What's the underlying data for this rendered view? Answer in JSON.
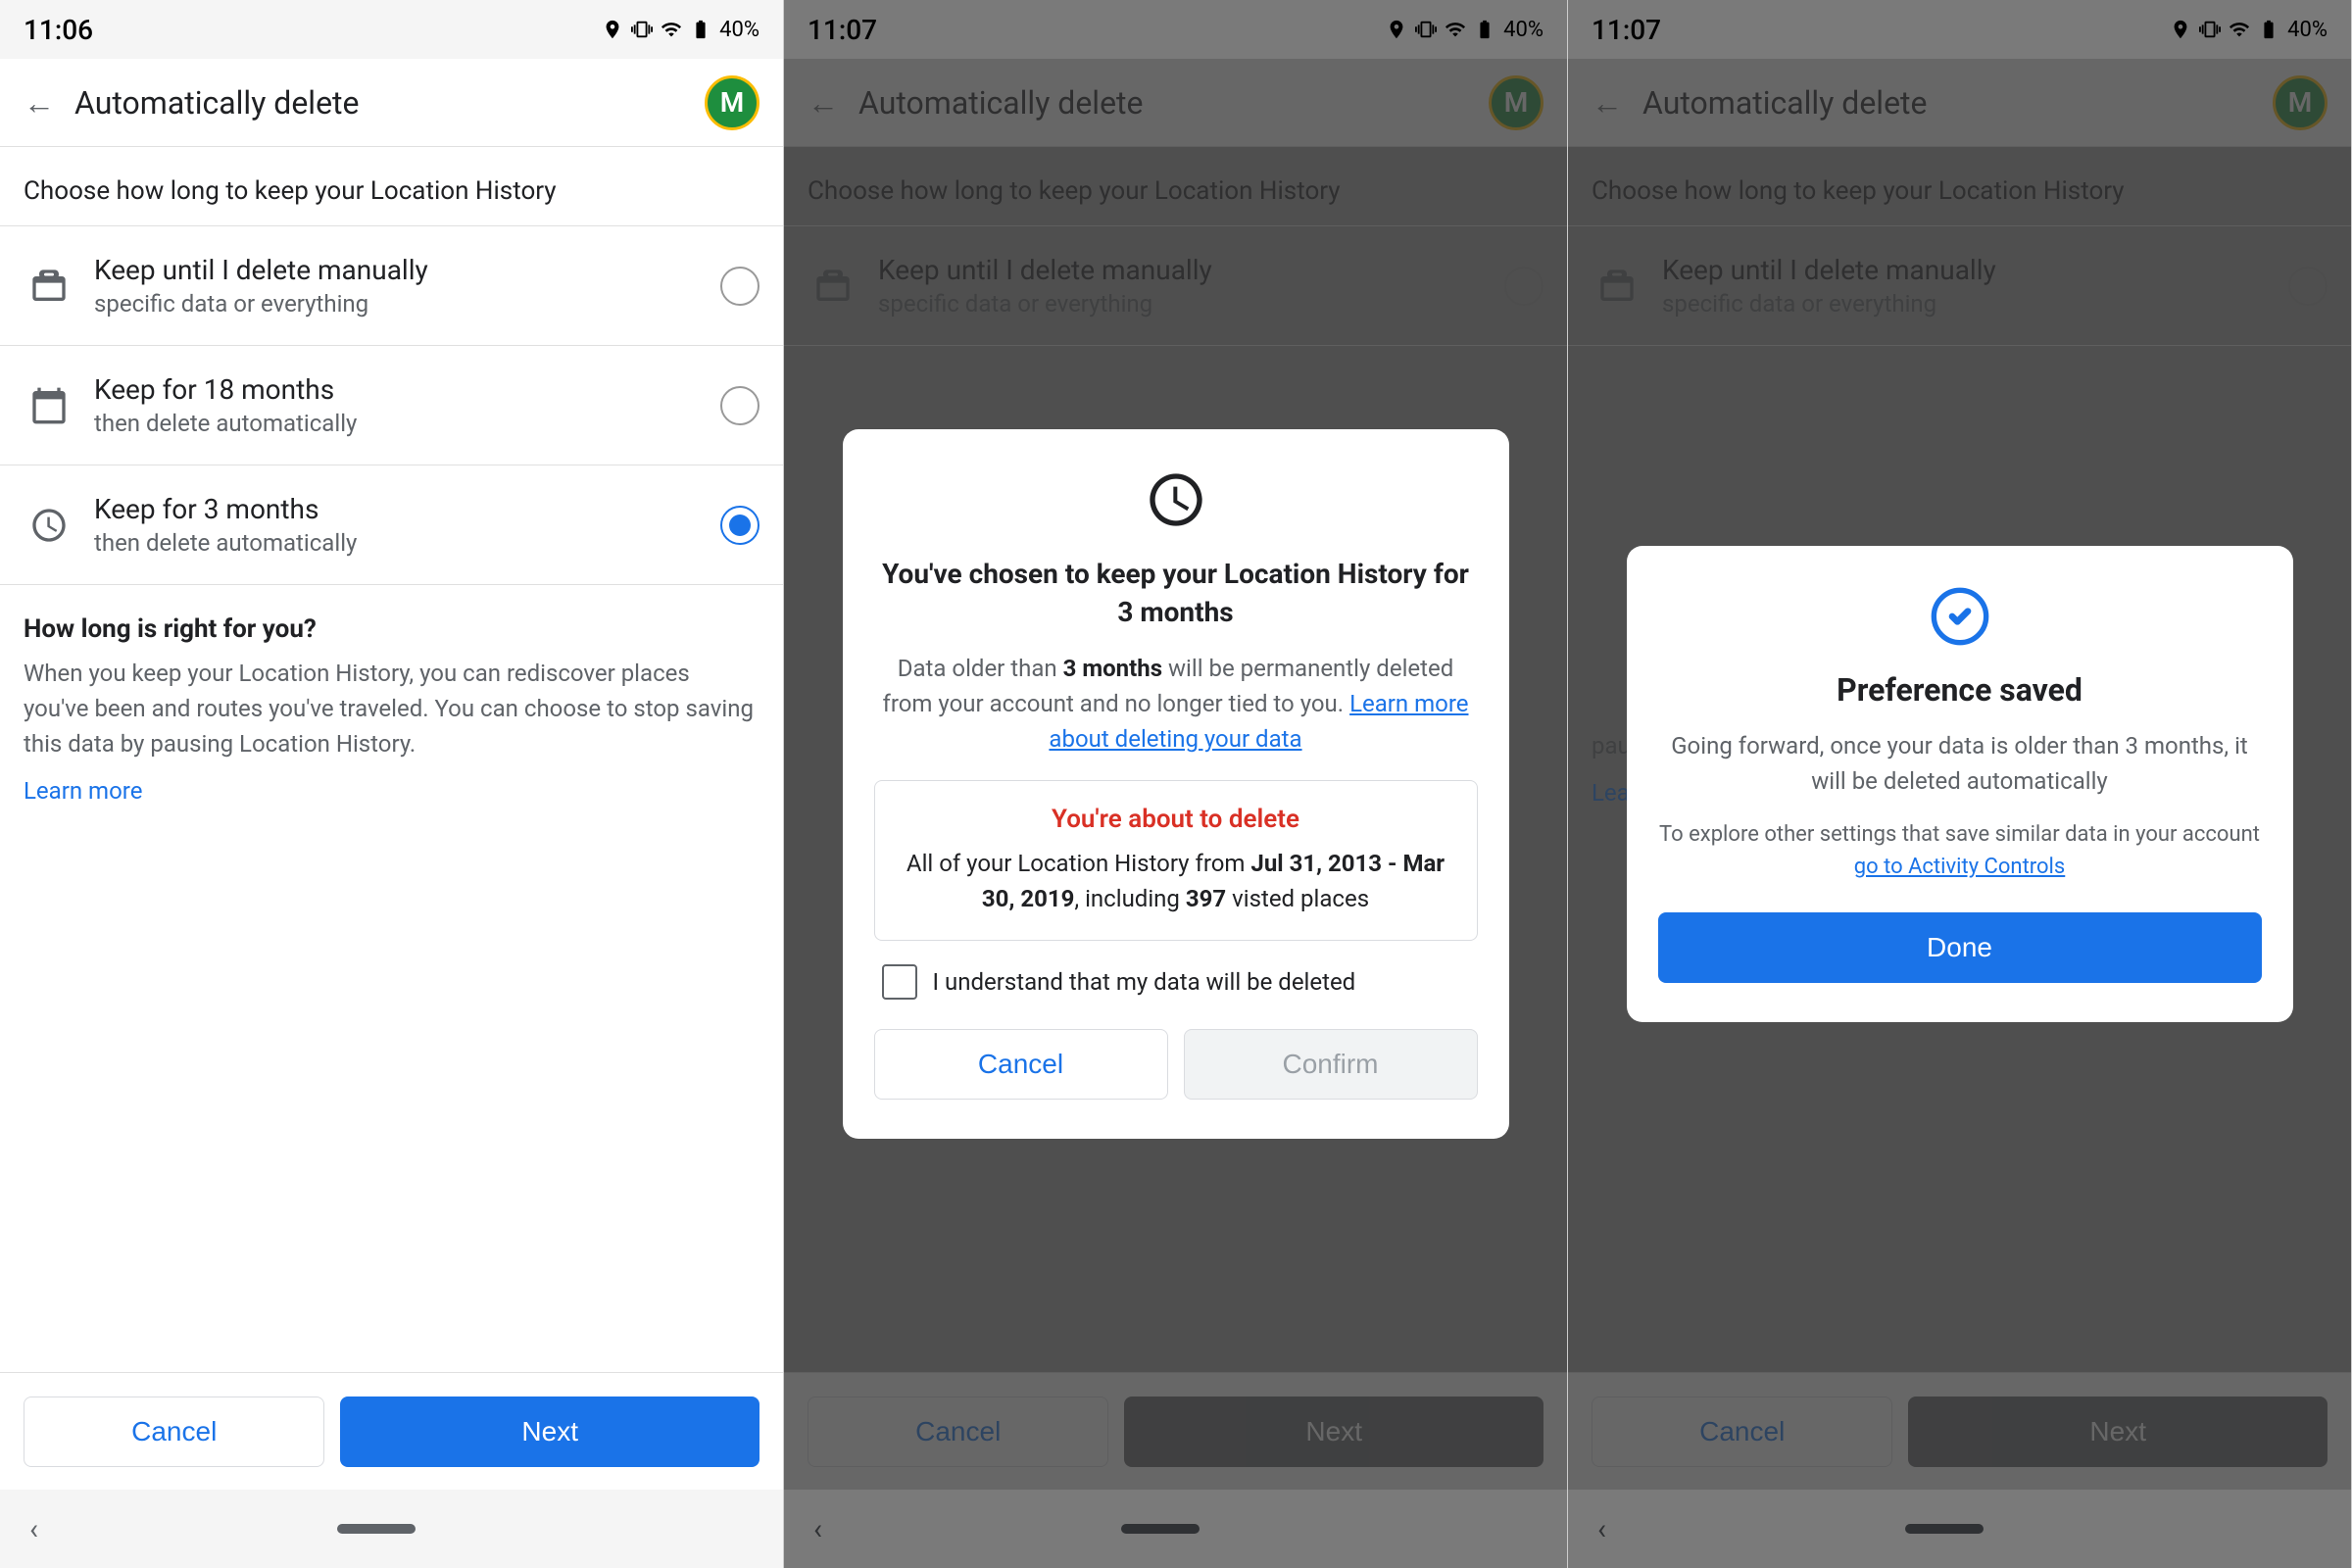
{
  "panels": [
    {
      "id": "panel1",
      "statusBar": {
        "time": "11:06",
        "battery": "40%"
      },
      "header": {
        "title": "Automatically delete",
        "avatarLetter": "M"
      },
      "subtitle": "Choose how long to keep your Location History",
      "options": [
        {
          "id": "opt-manual",
          "icon": "briefcase",
          "title": "Keep until I delete manually",
          "subtitle": "specific data or everything",
          "selected": false
        },
        {
          "id": "opt-18months",
          "icon": "calendar",
          "title": "Keep for 18 months",
          "subtitle": "then delete automatically",
          "selected": false
        },
        {
          "id": "opt-3months",
          "icon": "clock",
          "title": "Keep for 3 months",
          "subtitle": "then delete automatically",
          "selected": true
        }
      ],
      "infoTitle": "How long is right for you?",
      "infoText": "When you keep your Location History, you can rediscover places you've been and routes you've traveled. You can choose to stop saving this data by pausing Location History.",
      "infoLink": "Learn more",
      "cancelLabel": "Cancel",
      "nextLabel": "Next"
    },
    {
      "id": "panel2",
      "statusBar": {
        "time": "11:07",
        "battery": "40%"
      },
      "header": {
        "title": "Automatically delete",
        "avatarLetter": "M"
      },
      "subtitle": "Choose how long to keep your Location History",
      "options": [
        {
          "id": "opt-manual2",
          "icon": "briefcase",
          "title": "Keep until I delete manually",
          "subtitle": "specific data or everything",
          "selected": false
        }
      ],
      "cancelLabel": "Cancel",
      "nextLabel": "Next",
      "dialog": {
        "iconType": "clock",
        "title": "You've chosen to keep your Location History for 3 months",
        "body": "Data older than",
        "boldPart": "3 months",
        "bodyContinue": "will be permanently deleted from your account and no longer tied to you.",
        "link": "Learn more about deleting your data",
        "warningTitle": "You're about to delete",
        "warningText": "All of your Location History from",
        "warningBold1": "Jul 31, 2013 - Mar 30, 2019",
        "warningContinue": ", including",
        "warningBold2": "397",
        "warningEnd": "visted places",
        "checkboxLabel": "I understand that my data will be deleted",
        "cancelLabel": "Cancel",
        "confirmLabel": "Confirm"
      }
    },
    {
      "id": "panel3",
      "statusBar": {
        "time": "11:07",
        "battery": "40%"
      },
      "header": {
        "title": "Automatically delete",
        "avatarLetter": "M"
      },
      "subtitle": "Choose how long to keep your Location History",
      "options": [
        {
          "id": "opt-manual3",
          "icon": "briefcase",
          "title": "Keep until I delete manually",
          "subtitle": "specific data or everything",
          "selected": false
        }
      ],
      "cancelLabel": "Cancel",
      "nextLabel": "Next",
      "infoText": "pausing Location History.",
      "infoLink": "Learn more",
      "prefDialog": {
        "iconType": "check-circle",
        "title": "Preference saved",
        "body": "Going forward, once your data is older than 3 months, it will be deleted automatically",
        "footer": "To explore other settings that save similar data in your account",
        "footerLink": "go to Activity Controls",
        "doneLabel": "Done"
      }
    }
  ],
  "colors": {
    "blue": "#1a73e8",
    "red": "#d93025",
    "gray": "#5f6368",
    "darkGray": "#3c4043"
  }
}
